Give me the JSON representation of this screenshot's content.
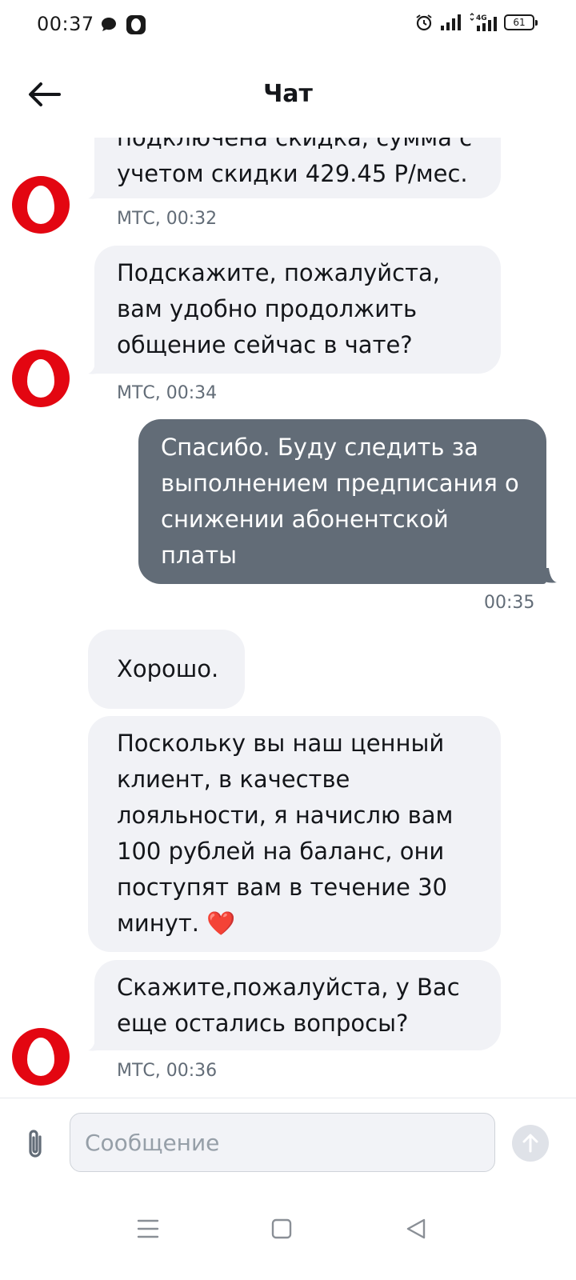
{
  "status_bar": {
    "time": "00:37",
    "battery": "61",
    "network": "4G"
  },
  "header": {
    "title": "Чат"
  },
  "messages": [
    {
      "from": "МТС",
      "lines": [
        "подключена скидка, сумма с",
        "учетом скидки 429.45 Р/мес."
      ],
      "meta": "МТС, 00:32"
    },
    {
      "from": "МТС",
      "lines": [
        "Подскажите, пожалуйста,",
        "вам удобно продолжить",
        "общение сейчас в чате?"
      ],
      "meta": "МТС, 00:34"
    },
    {
      "from": "user",
      "lines": [
        "Спасибо. Буду следить за",
        "выполнением предписания о",
        "снижении абонентской",
        "платы"
      ],
      "meta": "00:35"
    },
    {
      "from": "МТС",
      "lines": [
        "Хорошо."
      ]
    },
    {
      "from": "МТС",
      "lines": [
        "Поскольку вы наш ценный",
        "клиент, в качестве",
        "лояльности, я начислю вам",
        "100 рублей на баланс, они",
        "поступят вам в течение 30",
        "минут. ❤️"
      ]
    },
    {
      "from": "МТС",
      "lines": [
        "Скажите,пожалуйста, у Вас",
        "еще остались вопросы?"
      ],
      "meta": "МТС, 00:36"
    }
  ],
  "composer": {
    "placeholder": "Сообщение"
  },
  "icons": {
    "back": "arrow-left-icon",
    "attach": "paperclip-icon",
    "send": "arrow-up-icon",
    "avatar": "mts-logo-icon",
    "nav_menu": "menu-icon",
    "nav_home": "square-icon",
    "nav_back": "triangle-back-icon"
  },
  "colors": {
    "brand": "#e30611",
    "incoming_bubble": "#f1f2f6",
    "outgoing_bubble": "#626c77",
    "meta_text": "#626c77"
  }
}
